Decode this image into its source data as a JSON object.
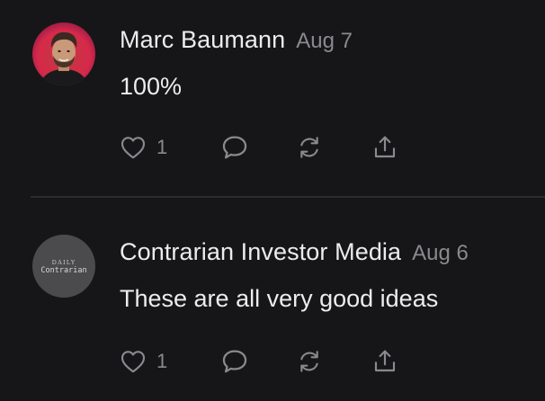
{
  "comments": [
    {
      "author": "Marc Baumann",
      "date": "Aug 7",
      "body": "100%",
      "like_count": "1",
      "avatar": "photo-avatar"
    },
    {
      "author": "Contrarian Investor Media",
      "date": "Aug 6",
      "body": "These are all very good ideas",
      "like_count": "1",
      "avatar": "logo-avatar",
      "avatar_logo_lines": [
        "DAILY",
        "Contrarian"
      ]
    }
  ],
  "colors": {
    "background": "#161618",
    "text": "#ececec",
    "muted": "#8a8a8e",
    "divider": "#2c2c2f"
  }
}
